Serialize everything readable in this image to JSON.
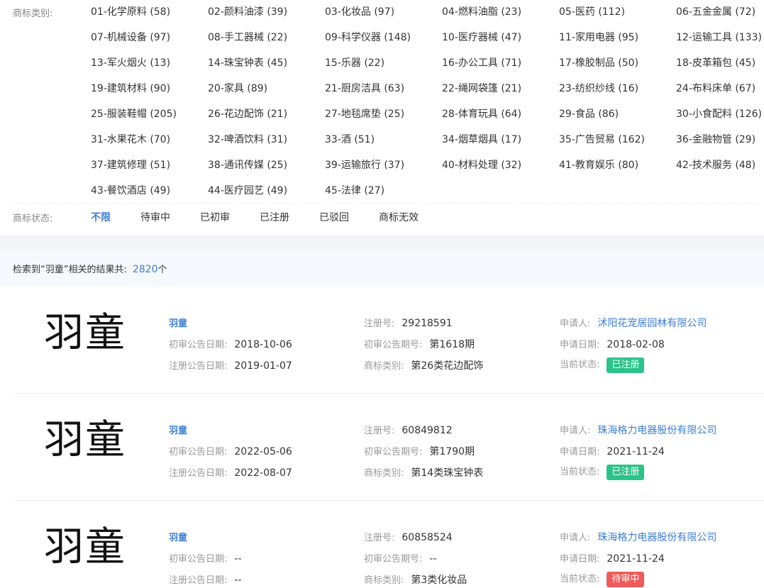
{
  "filters": {
    "category_label": "商标类别:",
    "categories": [
      "01-化学原料 (58)",
      "02-颜料油漆 (39)",
      "03-化妆品 (97)",
      "04-燃料油脂 (23)",
      "05-医药 (112)",
      "06-五金金属 (72)",
      "07-机械设备 (97)",
      "08-手工器械 (22)",
      "09-科学仪器 (148)",
      "10-医疗器械 (47)",
      "11-家用电器 (95)",
      "12-运输工具 (133)",
      "13-军火烟火 (13)",
      "14-珠宝钟表 (45)",
      "15-乐器 (22)",
      "16-办公工具 (71)",
      "17-橡胶制品 (50)",
      "18-皮革箱包 (45)",
      "19-建筑材料 (90)",
      "20-家具 (89)",
      "21-厨房洁具 (63)",
      "22-绳网袋篷 (21)",
      "23-纺织纱线 (16)",
      "24-布料床单 (67)",
      "25-服装鞋帽 (205)",
      "26-花边配饰 (21)",
      "27-地毯席垫 (25)",
      "28-体育玩具 (64)",
      "29-食品 (86)",
      "30-小食配料 (126)",
      "31-水果花木 (70)",
      "32-啤酒饮料 (31)",
      "33-酒 (51)",
      "34-烟草烟具 (17)",
      "35-广告贸易 (162)",
      "36-金融物管 (29)",
      "37-建筑修理 (51)",
      "38-通讯传媒 (25)",
      "39-运输旅行 (37)",
      "40-材料处理 (32)",
      "41-教育娱乐 (80)",
      "42-技术服务 (48)",
      "43-餐饮酒店 (49)",
      "44-医疗园艺 (49)",
      "45-法律 (27)"
    ],
    "status_label": "商标状态:",
    "statuses": [
      "不限",
      "待审中",
      "已初审",
      "已注册",
      "已驳回",
      "商标无效"
    ]
  },
  "summary": {
    "text": "检索到“羽童”相关的结果共:",
    "count": "2820",
    "unit": "个"
  },
  "labels": {
    "reg_no": "注册号:",
    "applicant": "申请人:",
    "prelim_date": "初审公告日期:",
    "prelim_issue": "初审公告期号:",
    "apply_date": "申请日期:",
    "reg_date": "注册公告日期:",
    "category": "商标类别:",
    "status": "当前状态:"
  },
  "results": [
    {
      "mark_image_text": "羽童",
      "name": "羽童",
      "reg_no": "29218591",
      "applicant": "沭阳花宠居园林有限公司",
      "prelim_date": "2018-10-06",
      "prelim_issue": "第1618期",
      "apply_date": "2018-02-08",
      "reg_date": "2019-01-07",
      "category": "第26类花边配饰",
      "status": "已注册",
      "status_color": "#2bc38a"
    },
    {
      "mark_image_text": "羽童",
      "name": "羽童",
      "reg_no": "60849812",
      "applicant": "珠海格力电器股份有限公司",
      "prelim_date": "2022-05-06",
      "prelim_issue": "第1790期",
      "apply_date": "2021-11-24",
      "reg_date": "2022-08-07",
      "category": "第14类珠宝钟表",
      "status": "已注册",
      "status_color": "#2bc38a"
    },
    {
      "mark_image_text": "羽童",
      "name": "羽童",
      "reg_no": "60858524",
      "applicant": "珠海格力电器股份有限公司",
      "prelim_date": "--",
      "prelim_issue": "--",
      "apply_date": "2021-11-24",
      "reg_date": "--",
      "category": "第3类化妆品",
      "status": "待审中",
      "status_color": "#f05a5a"
    }
  ]
}
